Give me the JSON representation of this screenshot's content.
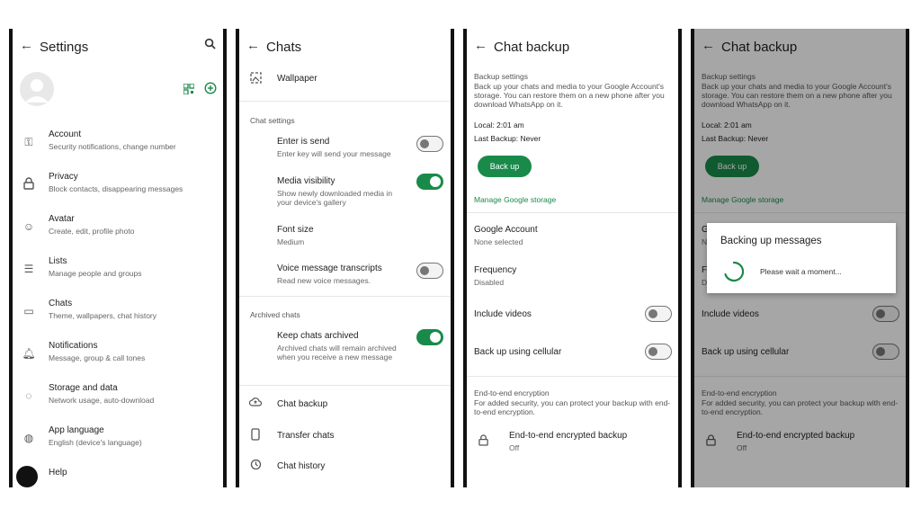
{
  "settings": {
    "title": "Settings",
    "items": [
      {
        "title": "Account",
        "sub": "Security notifications, change number",
        "icon": "key-icon"
      },
      {
        "title": "Privacy",
        "sub": "Block contacts, disappearing messages",
        "icon": "lock-icon"
      },
      {
        "title": "Avatar",
        "sub": "Create, edit, profile photo",
        "icon": "avatar-icon"
      },
      {
        "title": "Lists",
        "sub": "Manage people and groups",
        "icon": "lists-icon"
      },
      {
        "title": "Chats",
        "sub": "Theme, wallpapers, chat history",
        "icon": "chat-icon"
      },
      {
        "title": "Notifications",
        "sub": "Message, group & call tones",
        "icon": "bell-icon"
      },
      {
        "title": "Storage and data",
        "sub": "Network usage, auto-download",
        "icon": "storage-icon"
      },
      {
        "title": "App language",
        "sub": "English (device's language)",
        "icon": "globe-icon"
      },
      {
        "title": "Help",
        "sub": "",
        "icon": "help-icon"
      }
    ]
  },
  "chats": {
    "title": "Chats",
    "wallpaper": "Wallpaper",
    "chat_settings_label": "Chat settings",
    "enter_is_send": {
      "title": "Enter is send",
      "sub": "Enter key will send your message",
      "on": false
    },
    "media_visibility": {
      "title": "Media visibility",
      "sub": "Show newly downloaded media in your device's gallery",
      "on": true
    },
    "font_size": {
      "title": "Font size",
      "sub": "Medium"
    },
    "voice_transcripts": {
      "title": "Voice message transcripts",
      "sub": "Read new voice messages.",
      "on": false
    },
    "archived_label": "Archived chats",
    "keep_archived": {
      "title": "Keep chats archived",
      "sub": "Archived chats will remain archived when you receive a new message",
      "on": true
    },
    "chat_backup": "Chat backup",
    "transfer_chats": "Transfer chats",
    "chat_history": "Chat history"
  },
  "backup": {
    "title": "Chat backup",
    "settings_label": "Backup settings",
    "desc": "Back up your chats and media to your Google Account's storage. You can restore them on a new phone after you download WhatsApp on it.",
    "local": "Local: 2:01 am",
    "last": "Last Backup: Never",
    "button": "Back up",
    "manage": "Manage Google storage",
    "google_account": {
      "title": "Google Account",
      "sub": "None selected"
    },
    "frequency": {
      "title": "Frequency",
      "sub": "Disabled"
    },
    "include_videos": "Include videos",
    "cellular": "Back up using cellular",
    "e2e_label": "End-to-end encryption",
    "e2e_desc": "For added security, you can protect your backup with end-to-end encryption.",
    "e2e_item": {
      "title": "End-to-end encrypted backup",
      "sub": "Off"
    }
  },
  "dialog": {
    "title": "Backing up messages",
    "text": "Please wait a moment..."
  },
  "colors": {
    "accent": "#1a8a4a"
  }
}
